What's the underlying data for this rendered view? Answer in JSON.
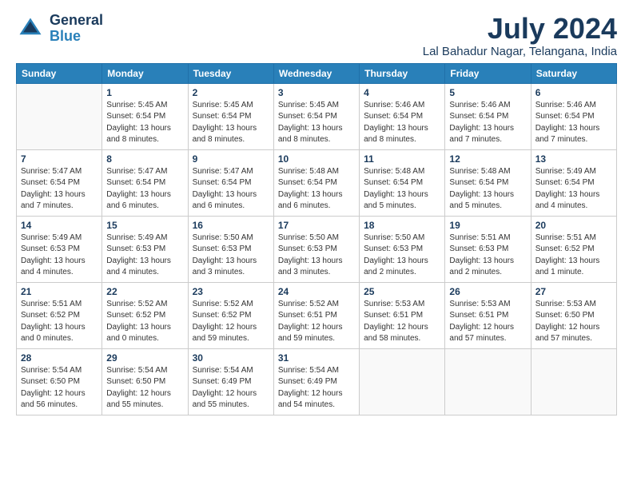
{
  "logo": {
    "line1": "General",
    "line2": "Blue"
  },
  "title": "July 2024",
  "location": "Lal Bahadur Nagar, Telangana, India",
  "days_of_week": [
    "Sunday",
    "Monday",
    "Tuesday",
    "Wednesday",
    "Thursday",
    "Friday",
    "Saturday"
  ],
  "weeks": [
    [
      {
        "day": "",
        "info": ""
      },
      {
        "day": "1",
        "info": "Sunrise: 5:45 AM\nSunset: 6:54 PM\nDaylight: 13 hours\nand 8 minutes."
      },
      {
        "day": "2",
        "info": "Sunrise: 5:45 AM\nSunset: 6:54 PM\nDaylight: 13 hours\nand 8 minutes."
      },
      {
        "day": "3",
        "info": "Sunrise: 5:45 AM\nSunset: 6:54 PM\nDaylight: 13 hours\nand 8 minutes."
      },
      {
        "day": "4",
        "info": "Sunrise: 5:46 AM\nSunset: 6:54 PM\nDaylight: 13 hours\nand 8 minutes."
      },
      {
        "day": "5",
        "info": "Sunrise: 5:46 AM\nSunset: 6:54 PM\nDaylight: 13 hours\nand 7 minutes."
      },
      {
        "day": "6",
        "info": "Sunrise: 5:46 AM\nSunset: 6:54 PM\nDaylight: 13 hours\nand 7 minutes."
      }
    ],
    [
      {
        "day": "7",
        "info": "Sunrise: 5:47 AM\nSunset: 6:54 PM\nDaylight: 13 hours\nand 7 minutes."
      },
      {
        "day": "8",
        "info": "Sunrise: 5:47 AM\nSunset: 6:54 PM\nDaylight: 13 hours\nand 6 minutes."
      },
      {
        "day": "9",
        "info": "Sunrise: 5:47 AM\nSunset: 6:54 PM\nDaylight: 13 hours\nand 6 minutes."
      },
      {
        "day": "10",
        "info": "Sunrise: 5:48 AM\nSunset: 6:54 PM\nDaylight: 13 hours\nand 6 minutes."
      },
      {
        "day": "11",
        "info": "Sunrise: 5:48 AM\nSunset: 6:54 PM\nDaylight: 13 hours\nand 5 minutes."
      },
      {
        "day": "12",
        "info": "Sunrise: 5:48 AM\nSunset: 6:54 PM\nDaylight: 13 hours\nand 5 minutes."
      },
      {
        "day": "13",
        "info": "Sunrise: 5:49 AM\nSunset: 6:54 PM\nDaylight: 13 hours\nand 4 minutes."
      }
    ],
    [
      {
        "day": "14",
        "info": "Sunrise: 5:49 AM\nSunset: 6:53 PM\nDaylight: 13 hours\nand 4 minutes."
      },
      {
        "day": "15",
        "info": "Sunrise: 5:49 AM\nSunset: 6:53 PM\nDaylight: 13 hours\nand 4 minutes."
      },
      {
        "day": "16",
        "info": "Sunrise: 5:50 AM\nSunset: 6:53 PM\nDaylight: 13 hours\nand 3 minutes."
      },
      {
        "day": "17",
        "info": "Sunrise: 5:50 AM\nSunset: 6:53 PM\nDaylight: 13 hours\nand 3 minutes."
      },
      {
        "day": "18",
        "info": "Sunrise: 5:50 AM\nSunset: 6:53 PM\nDaylight: 13 hours\nand 2 minutes."
      },
      {
        "day": "19",
        "info": "Sunrise: 5:51 AM\nSunset: 6:53 PM\nDaylight: 13 hours\nand 2 minutes."
      },
      {
        "day": "20",
        "info": "Sunrise: 5:51 AM\nSunset: 6:52 PM\nDaylight: 13 hours\nand 1 minute."
      }
    ],
    [
      {
        "day": "21",
        "info": "Sunrise: 5:51 AM\nSunset: 6:52 PM\nDaylight: 13 hours\nand 0 minutes."
      },
      {
        "day": "22",
        "info": "Sunrise: 5:52 AM\nSunset: 6:52 PM\nDaylight: 13 hours\nand 0 minutes."
      },
      {
        "day": "23",
        "info": "Sunrise: 5:52 AM\nSunset: 6:52 PM\nDaylight: 12 hours\nand 59 minutes."
      },
      {
        "day": "24",
        "info": "Sunrise: 5:52 AM\nSunset: 6:51 PM\nDaylight: 12 hours\nand 59 minutes."
      },
      {
        "day": "25",
        "info": "Sunrise: 5:53 AM\nSunset: 6:51 PM\nDaylight: 12 hours\nand 58 minutes."
      },
      {
        "day": "26",
        "info": "Sunrise: 5:53 AM\nSunset: 6:51 PM\nDaylight: 12 hours\nand 57 minutes."
      },
      {
        "day": "27",
        "info": "Sunrise: 5:53 AM\nSunset: 6:50 PM\nDaylight: 12 hours\nand 57 minutes."
      }
    ],
    [
      {
        "day": "28",
        "info": "Sunrise: 5:54 AM\nSunset: 6:50 PM\nDaylight: 12 hours\nand 56 minutes."
      },
      {
        "day": "29",
        "info": "Sunrise: 5:54 AM\nSunset: 6:50 PM\nDaylight: 12 hours\nand 55 minutes."
      },
      {
        "day": "30",
        "info": "Sunrise: 5:54 AM\nSunset: 6:49 PM\nDaylight: 12 hours\nand 55 minutes."
      },
      {
        "day": "31",
        "info": "Sunrise: 5:54 AM\nSunset: 6:49 PM\nDaylight: 12 hours\nand 54 minutes."
      },
      {
        "day": "",
        "info": ""
      },
      {
        "day": "",
        "info": ""
      },
      {
        "day": "",
        "info": ""
      }
    ]
  ]
}
